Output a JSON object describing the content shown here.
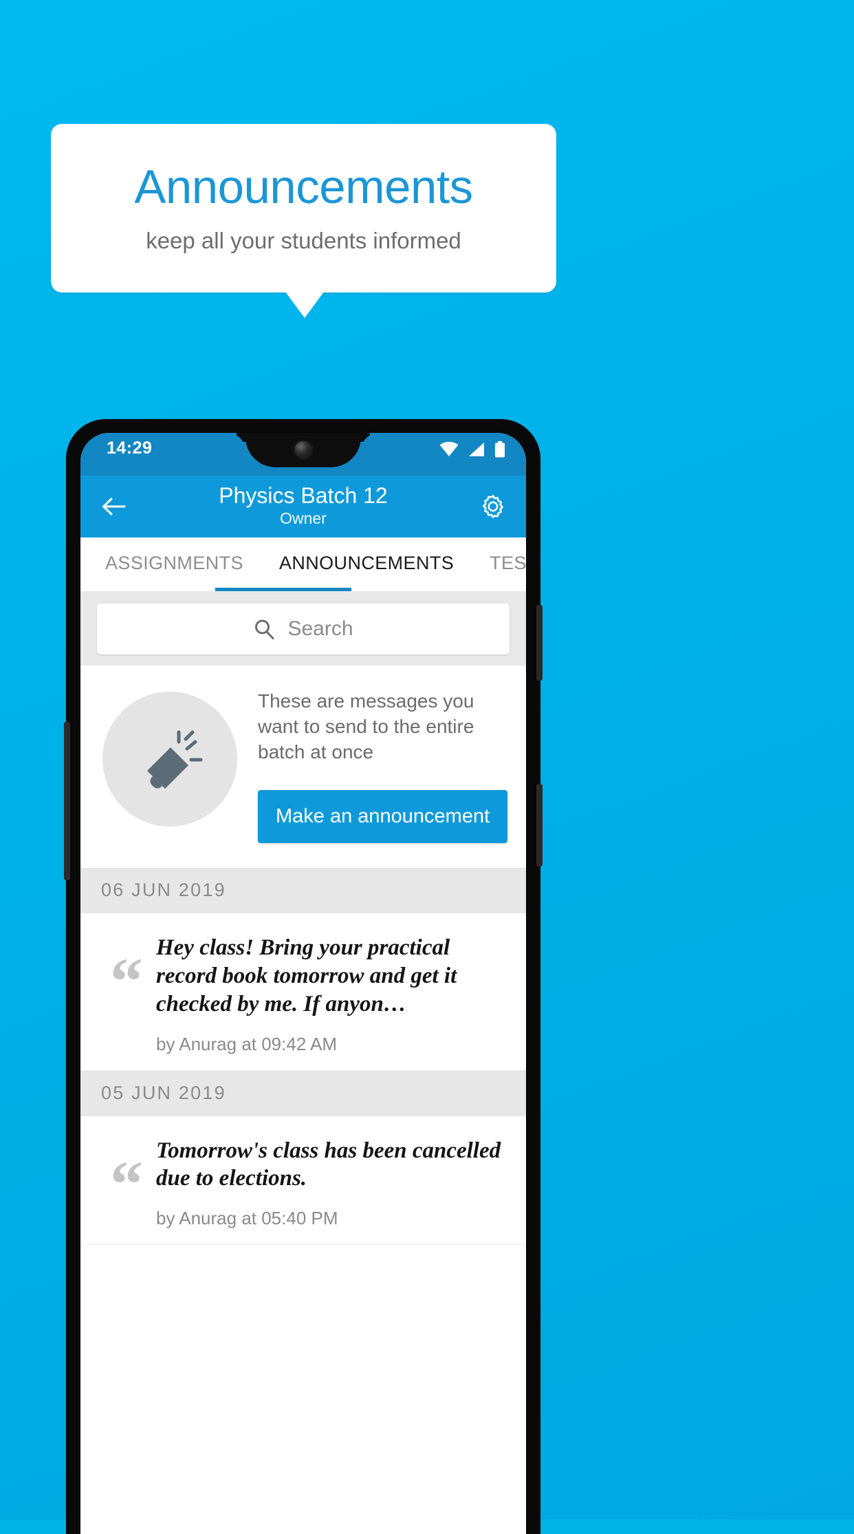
{
  "promo": {
    "title": "Announcements",
    "subtitle": "keep all your students informed",
    "title_color": "#1b96d6",
    "background_color": "#00b4ea"
  },
  "phone": {
    "statusbar": {
      "time": "14:29",
      "icons": [
        "wifi-icon",
        "cellular-signal-icon",
        "battery-icon"
      ]
    },
    "appbar": {
      "back_icon": "back-arrow-icon",
      "title": "Physics Batch 12",
      "subtitle": "Owner",
      "settings_icon": "gear-icon",
      "color": "#0e9ada"
    },
    "tabs": {
      "items": [
        {
          "label": "ASSIGNMENTS",
          "active": false
        },
        {
          "label": "ANNOUNCEMENTS",
          "active": true
        },
        {
          "label": "TESTS",
          "active": false
        },
        {
          "label": "’",
          "active": false
        }
      ],
      "indicator_color": "#1387c4"
    },
    "search": {
      "placeholder": "Search",
      "icon": "search-icon"
    },
    "prompt": {
      "icon": "megaphone-icon",
      "text": "These are messages you want to send to the entire batch at once",
      "button_label": "Make an announcement",
      "button_color": "#0e9ada"
    },
    "feed": [
      {
        "date": "06  JUN  2019",
        "items": [
          {
            "text": "Hey class! Bring your practical record book tomorrow and get it checked by me. If anyon…",
            "meta": "by Anurag at 09:42 AM"
          }
        ]
      },
      {
        "date": "05  JUN  2019",
        "items": [
          {
            "text": "Tomorrow's class has been cancelled due to elections.",
            "meta": "by Anurag at 05:40 PM"
          }
        ]
      }
    ]
  }
}
